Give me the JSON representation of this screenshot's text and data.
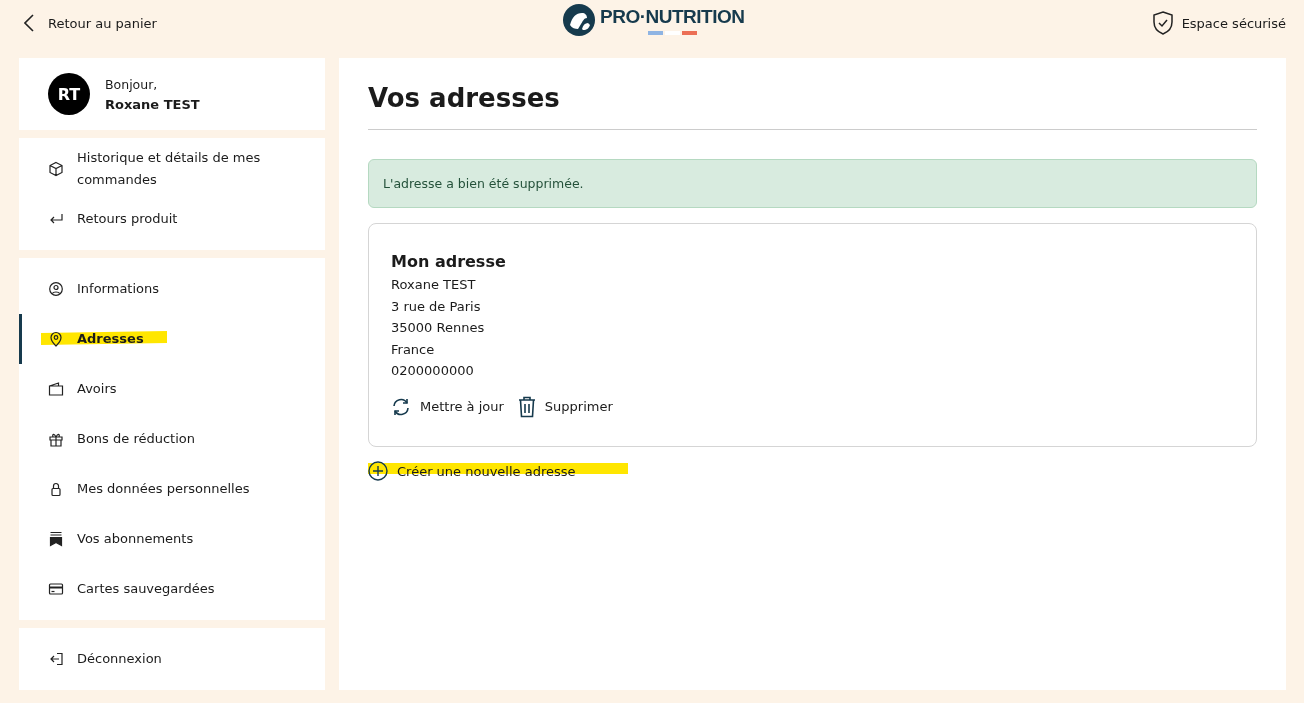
{
  "header": {
    "back_link": "Retour au panier",
    "logo": "PRO·NUTRITION",
    "secure": "Espace sécurisé"
  },
  "profile": {
    "initials": "RT",
    "greeting": "Bonjour,",
    "name": "Roxane TEST"
  },
  "sidebar": {
    "groups": [
      {
        "items": [
          {
            "label": "Historique et détails de mes commandes",
            "selected": false,
            "highlighted": false
          },
          {
            "label": "Retours produit",
            "selected": false,
            "highlighted": false
          }
        ]
      },
      {
        "items": [
          {
            "label": "Informations",
            "selected": false,
            "highlighted": false
          },
          {
            "label": "Adresses",
            "selected": true,
            "highlighted": true
          },
          {
            "label": "Avoirs",
            "selected": false,
            "highlighted": false
          },
          {
            "label": "Bons de réduction",
            "selected": false,
            "highlighted": false
          },
          {
            "label": "Mes données personnelles",
            "selected": false,
            "highlighted": false
          },
          {
            "label": "Vos abonnements",
            "selected": false,
            "highlighted": false
          },
          {
            "label": "Cartes sauvegardées",
            "selected": false,
            "highlighted": false
          }
        ]
      },
      {
        "items": [
          {
            "label": "Déconnexion",
            "selected": false,
            "highlighted": false
          }
        ]
      }
    ]
  },
  "main": {
    "title": "Vos adresses",
    "alert": "L'adresse a bien été supprimée.",
    "address": {
      "title": "Mon adresse",
      "lines": [
        "Roxane TEST",
        "3 rue de Paris",
        "35000 Rennes",
        "France",
        "0200000000"
      ],
      "actions": [
        "Mettre à jour",
        "Supprimer"
      ]
    },
    "create_link": {
      "label": "Créer une nouvelle adresse",
      "highlighted": true
    }
  }
}
